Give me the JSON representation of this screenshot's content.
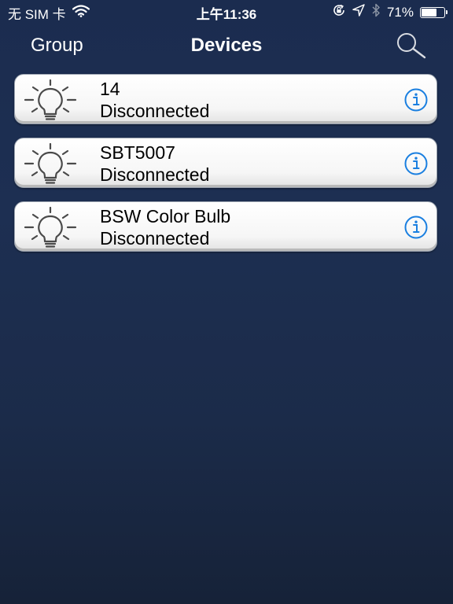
{
  "status_bar": {
    "carrier": "无 SIM 卡",
    "time": "上午11:36",
    "battery_percent": "71%",
    "battery_level": 0.71
  },
  "nav": {
    "left_label": "Group",
    "title": "Devices"
  },
  "devices": [
    {
      "name": "14",
      "status": "Disconnected"
    },
    {
      "name": "SBT5007",
      "status": "Disconnected"
    },
    {
      "name": "BSW Color Bulb",
      "status": "Disconnected"
    }
  ],
  "icons": {
    "wifi": "wifi-icon",
    "rotation_lock": "rotation-lock-icon",
    "location": "location-icon",
    "bluetooth": "bluetooth-icon",
    "battery": "battery-icon",
    "search": "search-icon",
    "bulb": "light-bulb-icon",
    "info": "info-icon"
  },
  "colors": {
    "background_top": "#1b2c4f",
    "background_bottom": "#162238",
    "card": "#ffffff",
    "info_accent": "#1a7fe0"
  }
}
